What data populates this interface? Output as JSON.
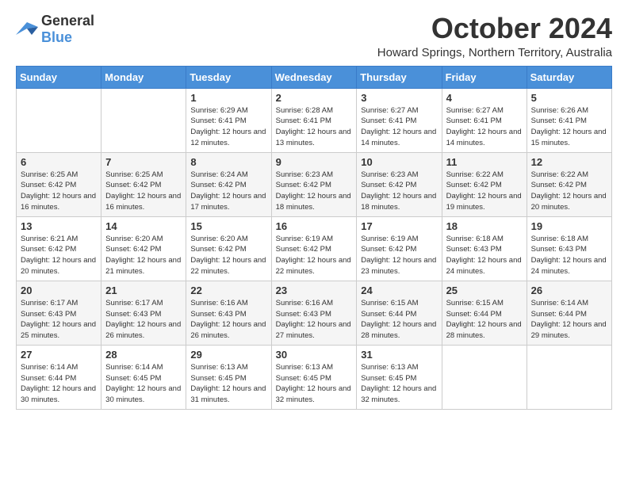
{
  "logo": {
    "text_general": "General",
    "text_blue": "Blue"
  },
  "title": "October 2024",
  "subtitle": "Howard Springs, Northern Territory, Australia",
  "days_of_week": [
    "Sunday",
    "Monday",
    "Tuesday",
    "Wednesday",
    "Thursday",
    "Friday",
    "Saturday"
  ],
  "weeks": [
    [
      {
        "day": null
      },
      {
        "day": null
      },
      {
        "day": "1",
        "info": "Sunrise: 6:29 AM\nSunset: 6:41 PM\nDaylight: 12 hours and 12 minutes."
      },
      {
        "day": "2",
        "info": "Sunrise: 6:28 AM\nSunset: 6:41 PM\nDaylight: 12 hours and 13 minutes."
      },
      {
        "day": "3",
        "info": "Sunrise: 6:27 AM\nSunset: 6:41 PM\nDaylight: 12 hours and 14 minutes."
      },
      {
        "day": "4",
        "info": "Sunrise: 6:27 AM\nSunset: 6:41 PM\nDaylight: 12 hours and 14 minutes."
      },
      {
        "day": "5",
        "info": "Sunrise: 6:26 AM\nSunset: 6:41 PM\nDaylight: 12 hours and 15 minutes."
      }
    ],
    [
      {
        "day": "6",
        "info": "Sunrise: 6:25 AM\nSunset: 6:42 PM\nDaylight: 12 hours and 16 minutes."
      },
      {
        "day": "7",
        "info": "Sunrise: 6:25 AM\nSunset: 6:42 PM\nDaylight: 12 hours and 16 minutes."
      },
      {
        "day": "8",
        "info": "Sunrise: 6:24 AM\nSunset: 6:42 PM\nDaylight: 12 hours and 17 minutes."
      },
      {
        "day": "9",
        "info": "Sunrise: 6:23 AM\nSunset: 6:42 PM\nDaylight: 12 hours and 18 minutes."
      },
      {
        "day": "10",
        "info": "Sunrise: 6:23 AM\nSunset: 6:42 PM\nDaylight: 12 hours and 18 minutes."
      },
      {
        "day": "11",
        "info": "Sunrise: 6:22 AM\nSunset: 6:42 PM\nDaylight: 12 hours and 19 minutes."
      },
      {
        "day": "12",
        "info": "Sunrise: 6:22 AM\nSunset: 6:42 PM\nDaylight: 12 hours and 20 minutes."
      }
    ],
    [
      {
        "day": "13",
        "info": "Sunrise: 6:21 AM\nSunset: 6:42 PM\nDaylight: 12 hours and 20 minutes."
      },
      {
        "day": "14",
        "info": "Sunrise: 6:20 AM\nSunset: 6:42 PM\nDaylight: 12 hours and 21 minutes."
      },
      {
        "day": "15",
        "info": "Sunrise: 6:20 AM\nSunset: 6:42 PM\nDaylight: 12 hours and 22 minutes."
      },
      {
        "day": "16",
        "info": "Sunrise: 6:19 AM\nSunset: 6:42 PM\nDaylight: 12 hours and 22 minutes."
      },
      {
        "day": "17",
        "info": "Sunrise: 6:19 AM\nSunset: 6:42 PM\nDaylight: 12 hours and 23 minutes."
      },
      {
        "day": "18",
        "info": "Sunrise: 6:18 AM\nSunset: 6:43 PM\nDaylight: 12 hours and 24 minutes."
      },
      {
        "day": "19",
        "info": "Sunrise: 6:18 AM\nSunset: 6:43 PM\nDaylight: 12 hours and 24 minutes."
      }
    ],
    [
      {
        "day": "20",
        "info": "Sunrise: 6:17 AM\nSunset: 6:43 PM\nDaylight: 12 hours and 25 minutes."
      },
      {
        "day": "21",
        "info": "Sunrise: 6:17 AM\nSunset: 6:43 PM\nDaylight: 12 hours and 26 minutes."
      },
      {
        "day": "22",
        "info": "Sunrise: 6:16 AM\nSunset: 6:43 PM\nDaylight: 12 hours and 26 minutes."
      },
      {
        "day": "23",
        "info": "Sunrise: 6:16 AM\nSunset: 6:43 PM\nDaylight: 12 hours and 27 minutes."
      },
      {
        "day": "24",
        "info": "Sunrise: 6:15 AM\nSunset: 6:44 PM\nDaylight: 12 hours and 28 minutes."
      },
      {
        "day": "25",
        "info": "Sunrise: 6:15 AM\nSunset: 6:44 PM\nDaylight: 12 hours and 28 minutes."
      },
      {
        "day": "26",
        "info": "Sunrise: 6:14 AM\nSunset: 6:44 PM\nDaylight: 12 hours and 29 minutes."
      }
    ],
    [
      {
        "day": "27",
        "info": "Sunrise: 6:14 AM\nSunset: 6:44 PM\nDaylight: 12 hours and 30 minutes."
      },
      {
        "day": "28",
        "info": "Sunrise: 6:14 AM\nSunset: 6:45 PM\nDaylight: 12 hours and 30 minutes."
      },
      {
        "day": "29",
        "info": "Sunrise: 6:13 AM\nSunset: 6:45 PM\nDaylight: 12 hours and 31 minutes."
      },
      {
        "day": "30",
        "info": "Sunrise: 6:13 AM\nSunset: 6:45 PM\nDaylight: 12 hours and 32 minutes."
      },
      {
        "day": "31",
        "info": "Sunrise: 6:13 AM\nSunset: 6:45 PM\nDaylight: 12 hours and 32 minutes."
      },
      {
        "day": null
      },
      {
        "day": null
      }
    ]
  ]
}
